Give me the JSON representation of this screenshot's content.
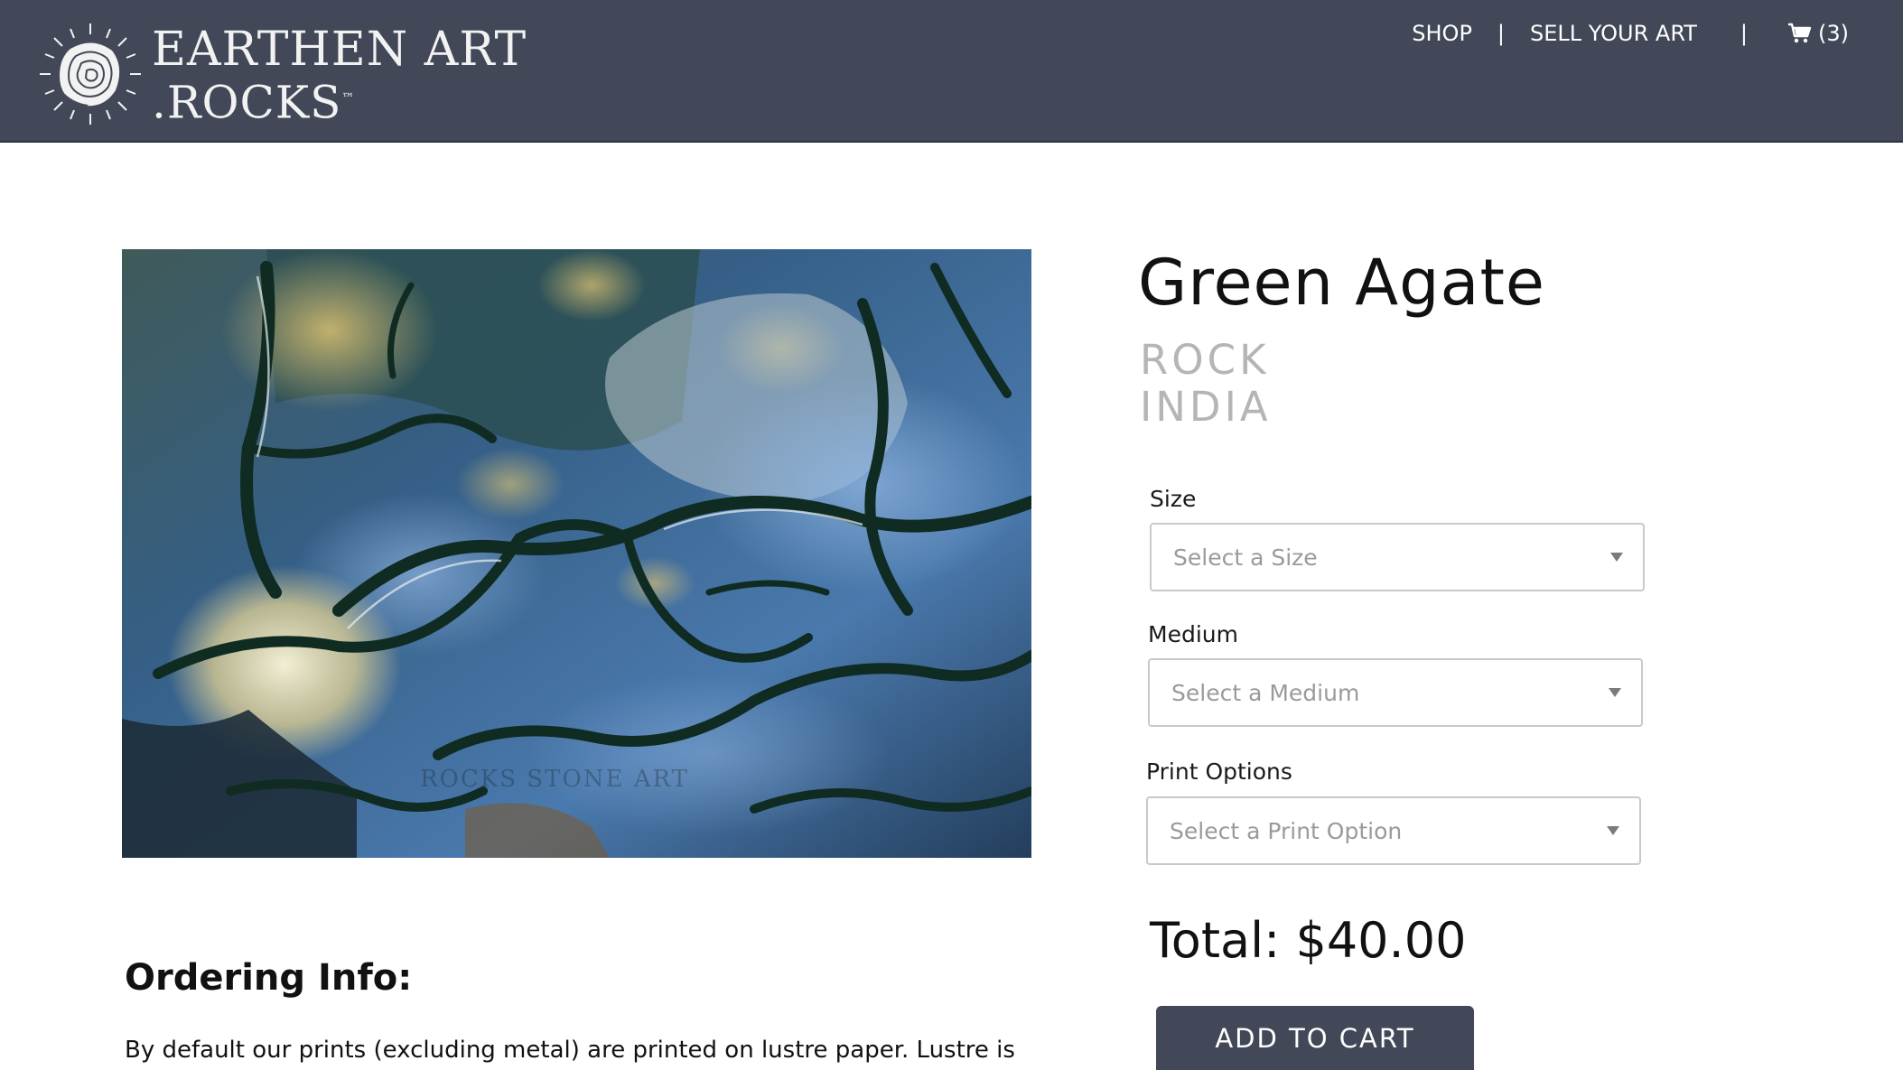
{
  "brand": {
    "line1": "EARTHEN ART",
    "line2": ".ROCKS",
    "trademark": "™",
    "logo_icon": "agate-slice-icon",
    "header_color": "#424857"
  },
  "nav": {
    "shop": "SHOP",
    "separator": "|",
    "sell": "SELL YOUR ART",
    "cart_icon": "cart-icon",
    "cart_count": "(3)"
  },
  "product": {
    "image_alt": "green-agate-photo",
    "watermark": "ROCKS STONE ART",
    "title": "Green Agate",
    "category": "ROCK",
    "origin": "INDIA"
  },
  "options": {
    "size_label": "Size",
    "size_placeholder": "Select a Size",
    "medium_label": "Medium",
    "medium_placeholder": "Select a Medium",
    "print_label": "Print Options",
    "print_placeholder": "Select a Print Option"
  },
  "total": {
    "text": "Total: $40.00"
  },
  "actions": {
    "add_to_cart": "ADD TO CART",
    "button_color": "#424857"
  },
  "ordering": {
    "heading": "Ordering Info:",
    "text": "By default our prints (excluding metal) are printed on lustre paper. Lustre is"
  }
}
